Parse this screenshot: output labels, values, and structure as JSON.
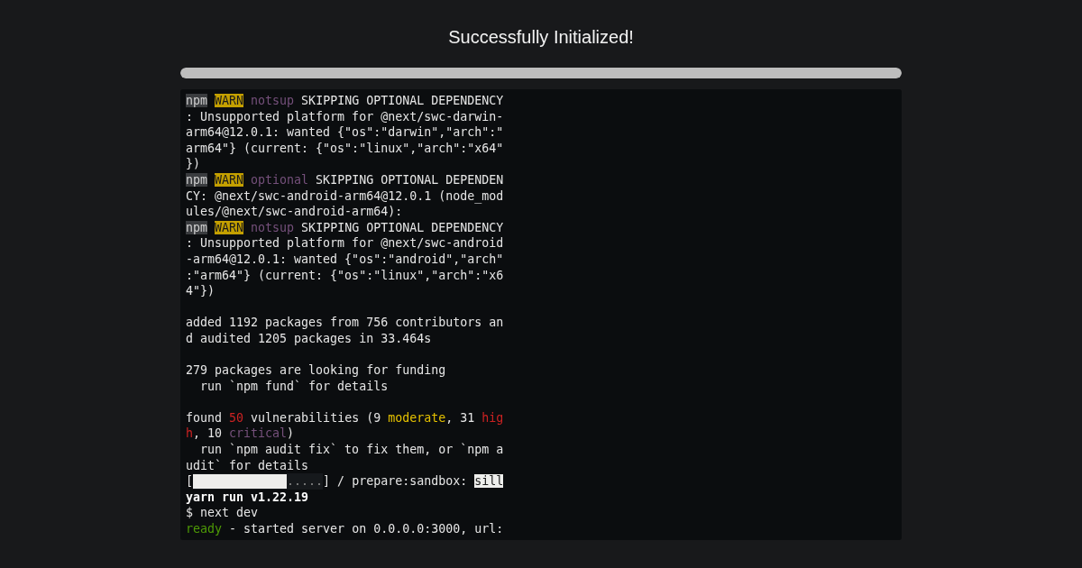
{
  "title": "Successfully Initialized!",
  "progress": {
    "level": 1
  },
  "terminal": {
    "lines": [
      {
        "segments": [
          {
            "kind": "npm",
            "text": "npm"
          },
          {
            "kind": "warn",
            "text": "WARN"
          },
          {
            "kind": "tag",
            "text": "notsup"
          },
          {
            "kind": "plain",
            "text": " SKIPPING OPTIONAL DEPENDENCY"
          }
        ]
      },
      {
        "segments": [
          {
            "kind": "plain",
            "text": ": Unsupported platform for @next/swc-darwin-"
          }
        ]
      },
      {
        "segments": [
          {
            "kind": "plain",
            "text": "arm64@12.0.1: wanted {\"os\":\"darwin\",\"arch\":\""
          }
        ]
      },
      {
        "segments": [
          {
            "kind": "plain",
            "text": "arm64\"} (current: {\"os\":\"linux\",\"arch\":\"x64\""
          }
        ]
      },
      {
        "segments": [
          {
            "kind": "plain",
            "text": "})"
          }
        ]
      },
      {
        "segments": [
          {
            "kind": "npm",
            "text": "npm"
          },
          {
            "kind": "warn",
            "text": "WARN"
          },
          {
            "kind": "tag",
            "text": "optional"
          },
          {
            "kind": "plain",
            "text": " SKIPPING OPTIONAL DEPENDEN"
          }
        ]
      },
      {
        "segments": [
          {
            "kind": "plain",
            "text": "CY: @next/swc-android-arm64@12.0.1 (node_mod"
          }
        ]
      },
      {
        "segments": [
          {
            "kind": "plain",
            "text": "ules/@next/swc-android-arm64):"
          }
        ]
      },
      {
        "segments": [
          {
            "kind": "npm",
            "text": "npm"
          },
          {
            "kind": "warn",
            "text": "WARN"
          },
          {
            "kind": "tag",
            "text": "notsup"
          },
          {
            "kind": "plain",
            "text": " SKIPPING OPTIONAL DEPENDENCY"
          }
        ]
      },
      {
        "segments": [
          {
            "kind": "plain",
            "text": ": Unsupported platform for @next/swc-android"
          }
        ]
      },
      {
        "segments": [
          {
            "kind": "plain",
            "text": "-arm64@12.0.1: wanted {\"os\":\"android\",\"arch\""
          }
        ]
      },
      {
        "segments": [
          {
            "kind": "plain",
            "text": ":\"arm64\"} (current: {\"os\":\"linux\",\"arch\":\"x6"
          }
        ]
      },
      {
        "segments": [
          {
            "kind": "plain",
            "text": "4\"})"
          }
        ],
        "gap_after": true
      },
      {
        "segments": [
          {
            "kind": "plain",
            "text": "added 1192 packages from 756 contributors an"
          }
        ]
      },
      {
        "segments": [
          {
            "kind": "plain",
            "text": "d audited 1205 packages in 33.464s"
          }
        ],
        "gap_after": true
      },
      {
        "segments": [
          {
            "kind": "plain",
            "text": "279 packages are looking for funding"
          }
        ]
      },
      {
        "segments": [
          {
            "kind": "plain",
            "text": "  run `npm fund` for details"
          }
        ],
        "gap_after": true
      },
      {
        "segments": [
          {
            "kind": "plain",
            "text": "found "
          },
          {
            "kind": "high",
            "text": "50"
          },
          {
            "kind": "plain",
            "text": " vulnerabilities (9 "
          },
          {
            "kind": "moderate",
            "text": "moderate"
          },
          {
            "kind": "plain",
            "text": ", 31 "
          },
          {
            "kind": "high",
            "text": "hig"
          }
        ]
      },
      {
        "segments": [
          {
            "kind": "high",
            "text": "h"
          },
          {
            "kind": "plain",
            "text": ", 10 "
          },
          {
            "kind": "tag_plain",
            "text": "critical"
          },
          {
            "kind": "plain",
            "text": ")"
          }
        ]
      },
      {
        "segments": [
          {
            "kind": "plain",
            "text": "  run `npm audit fix` to fix them, or `npm a"
          }
        ]
      },
      {
        "segments": [
          {
            "kind": "plain",
            "text": "udit` for details"
          }
        ]
      },
      {
        "segments": [
          {
            "kind": "plain",
            "text": "["
          },
          {
            "kind": "gauge",
            "level": 0.72,
            "text": "....."
          },
          {
            "kind": "plain",
            "text": "] / prepare:sandbox: "
          },
          {
            "kind": "highlight",
            "text": "sill"
          }
        ]
      },
      {
        "segments": [
          {
            "kind": "bold",
            "text": "yarn run v1.22.19"
          }
        ]
      },
      {
        "segments": [
          {
            "kind": "plain",
            "text": "$ next dev"
          }
        ]
      },
      {
        "segments": [
          {
            "kind": "ready",
            "text": "ready"
          },
          {
            "kind": "plain",
            "text": " - started server on 0.0.0.0:3000, url:"
          }
        ]
      }
    ]
  }
}
